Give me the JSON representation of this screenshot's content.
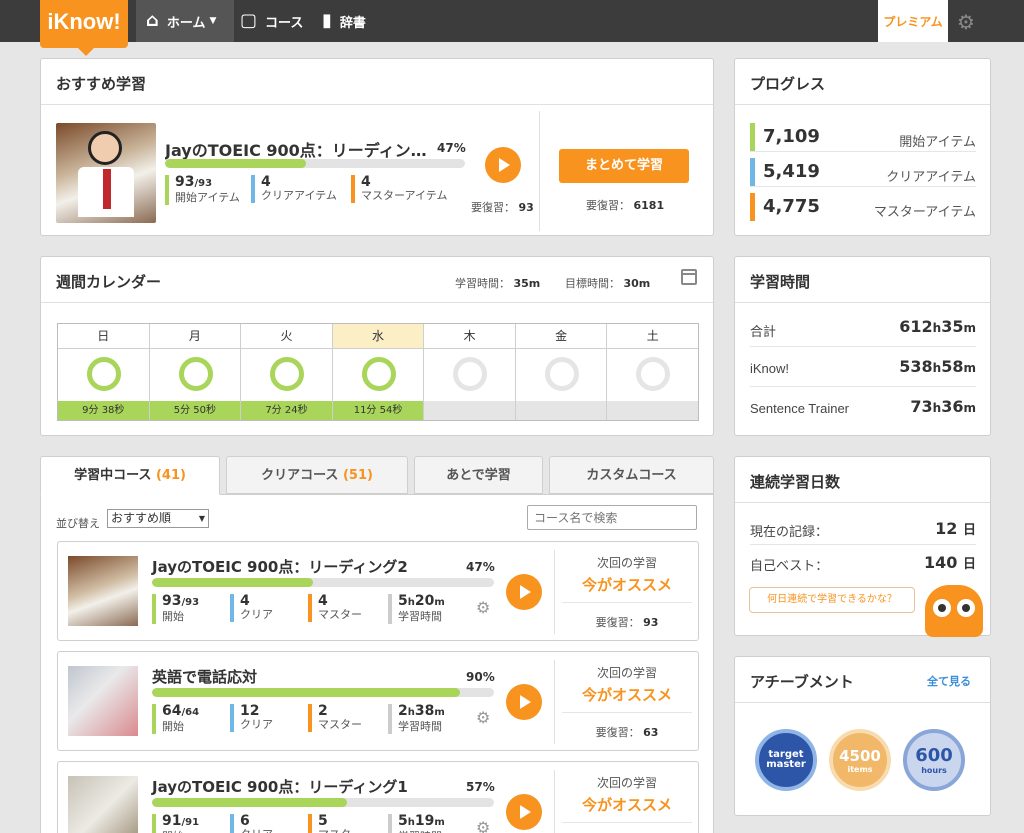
{
  "nav": {
    "logo": "iKnow!",
    "home": "ホーム",
    "course": "コース",
    "dictionary": "辞書",
    "premium": "プレミアム"
  },
  "recommended": {
    "title": "おすすめ学習",
    "course_title": "JayのTOEIC 900点：リーディン…",
    "percent": "47%",
    "progress": 0.47,
    "started_num": "93",
    "started_den": "/93",
    "started_label": "開始アイテム",
    "cleared_num": "4",
    "cleared_label": "クリアアイテム",
    "mastered_num": "4",
    "mastered_label": "マスターアイテム",
    "review_label": "要復習：",
    "review_count": "93",
    "batch_button": "まとめて学習",
    "batch_review_label": "要復習：",
    "batch_review_count": "6181"
  },
  "calendar": {
    "title": "週間カレンダー",
    "study_time_label": "学習時間：",
    "study_time": "35m",
    "target_time_label": "目標時間：",
    "target_time": "30m",
    "days": [
      {
        "name": "日",
        "time": "9分 38秒",
        "done": true,
        "today": false
      },
      {
        "name": "月",
        "time": "5分 50秒",
        "done": true,
        "today": false
      },
      {
        "name": "火",
        "time": "7分 24秒",
        "done": true,
        "today": false
      },
      {
        "name": "水",
        "time": "11分 54秒",
        "done": true,
        "today": true
      },
      {
        "name": "木",
        "time": "",
        "done": false,
        "today": false
      },
      {
        "name": "金",
        "time": "",
        "done": false,
        "today": false
      },
      {
        "name": "土",
        "time": "",
        "done": false,
        "today": false
      }
    ]
  },
  "tabs": [
    {
      "label": "学習中コース",
      "count": "(41)"
    },
    {
      "label": "クリアコース",
      "count": "(51)"
    },
    {
      "label": "あとで学習",
      "count": ""
    },
    {
      "label": "カスタムコース",
      "count": ""
    }
  ],
  "courses_panel": {
    "sort_label": "並び替え",
    "sort_value": "おすすめ順",
    "search_placeholder": "コース名で検索",
    "next_label": "次回の学習",
    "recommend_now": "今がオススメ",
    "review_label": "要復習："
  },
  "courses": [
    {
      "title": "JayのTOEIC 900点：リーディング2",
      "percent": "47%",
      "progress": 0.47,
      "started_num": "93",
      "started_den": "/93",
      "started_label": "開始",
      "cleared_num": "4",
      "cleared_label": "クリア",
      "mastered_num": "4",
      "mastered_label": "マスター",
      "time_h": "5",
      "time_m": "20",
      "time_label": "学習時間",
      "review_count": "93"
    },
    {
      "title": "英語で電話応対",
      "percent": "90%",
      "progress": 0.9,
      "started_num": "64",
      "started_den": "/64",
      "started_label": "開始",
      "cleared_num": "12",
      "cleared_label": "クリア",
      "mastered_num": "2",
      "mastered_label": "マスター",
      "time_h": "2",
      "time_m": "38",
      "time_label": "学習時間",
      "review_count": "63"
    },
    {
      "title": "JayのTOEIC 900点：リーディング1",
      "percent": "57%",
      "progress": 0.57,
      "started_num": "91",
      "started_den": "/91",
      "started_label": "開始",
      "cleared_num": "6",
      "cleared_label": "クリア",
      "mastered_num": "5",
      "mastered_label": "マスター",
      "time_h": "5",
      "time_m": "19",
      "time_label": "学習時間",
      "review_count": ""
    }
  ],
  "progress": {
    "title": "プログレス",
    "rows": [
      {
        "value": "7,109",
        "label": "開始アイテム",
        "color": "#a8d55a"
      },
      {
        "value": "5,419",
        "label": "クリアアイテム",
        "color": "#6fb7e6"
      },
      {
        "value": "4,775",
        "label": "マスターアイテム",
        "color": "#f7931e"
      }
    ]
  },
  "study_time": {
    "title": "学習時間",
    "rows": [
      {
        "label": "合計",
        "h": "612",
        "m": "35"
      },
      {
        "label": "iKnow!",
        "h": "538",
        "m": "58"
      },
      {
        "label": "Sentence Trainer",
        "h": "73",
        "m": "36"
      }
    ],
    "h_unit": "h",
    "m_unit": "m"
  },
  "streak": {
    "title": "連続学習日数",
    "current_label": "現在の記録：",
    "current_value": "12",
    "best_label": "自己ベスト：",
    "best_value": "140",
    "day_unit": "日",
    "bubble": "何日連続で学習できるかな？"
  },
  "achievements": {
    "title": "アチーブメント",
    "see_all": "全て見る",
    "badges": [
      {
        "line1": "target",
        "line2": "master"
      },
      {
        "line1": "4500",
        "line2": "items"
      },
      {
        "line1": "600",
        "line2": "hours"
      }
    ]
  },
  "colors": {
    "accent": "#f7931e",
    "green": "#a8d55a",
    "blue": "#6fb7e6",
    "link": "#3a8fd6"
  }
}
